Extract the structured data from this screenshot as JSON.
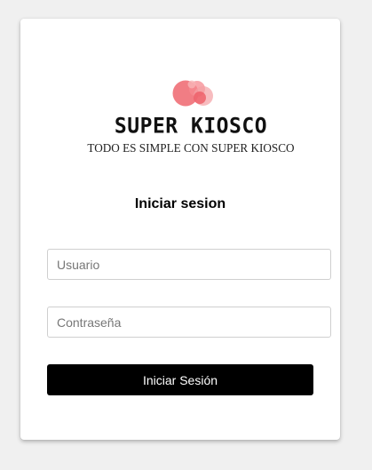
{
  "brand": {
    "name": "SUPER KIOSCO",
    "tagline": "TODO ES SIMPLE CON SUPER KIOSCO",
    "logo_icon": "bubbles-logo-icon",
    "logo_color": "#f0727a"
  },
  "login": {
    "title": "Iniciar sesion",
    "username_placeholder": "Usuario",
    "password_placeholder": "Contraseña",
    "submit_label": "Iniciar Sesión",
    "button_color": "#000000"
  }
}
